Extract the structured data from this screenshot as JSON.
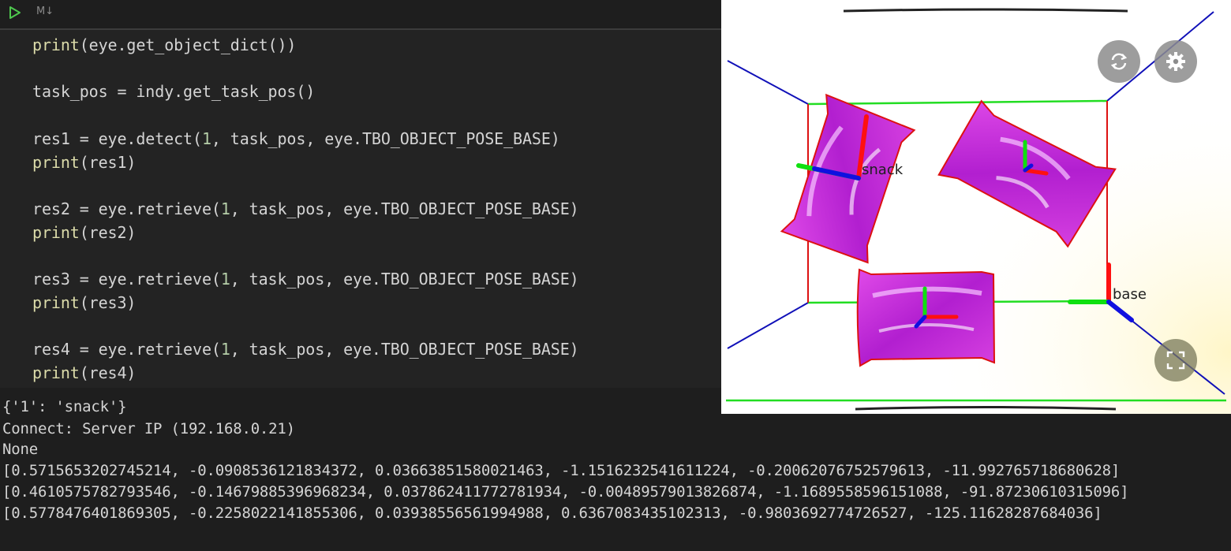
{
  "toolbar": {
    "run_icon": "play-icon",
    "markdown_badge": "M↓"
  },
  "code": {
    "lines": [
      {
        "parts": [
          "print",
          "(eye.get_object_dict())"
        ]
      },
      {
        "text": "task_pos = indy.get_task_pos()"
      },
      {
        "before": "res1 = eye.detect(",
        "num": "1",
        "after": ", task_pos, eye.TBO_OBJECT_POSE_BASE)"
      },
      {
        "parts": [
          "print",
          "(res1)"
        ]
      },
      {
        "before": "res2 = eye.retrieve(",
        "num": "1",
        "after": ", task_pos, eye.TBO_OBJECT_POSE_BASE)"
      },
      {
        "parts": [
          "print",
          "(res2)"
        ]
      },
      {
        "before": "res3 = eye.retrieve(",
        "num": "1",
        "after": ", task_pos, eye.TBO_OBJECT_POSE_BASE)"
      },
      {
        "parts": [
          "print",
          "(res3)"
        ]
      },
      {
        "before": "res4 = eye.retrieve(",
        "num": "1",
        "after": ", task_pos, eye.TBO_OBJECT_POSE_BASE)"
      },
      {
        "parts": [
          "print",
          "(res4)"
        ]
      }
    ]
  },
  "output": {
    "lines": [
      "{'1': 'snack'}",
      "Connect: Server IP (192.168.0.21)",
      "None",
      "[0.5715653202745214, -0.0908536121834372, 0.03663851580021463, -1.1516232541611224, -0.20062076752579613, -11.992765718680628]",
      "[0.4610575782793546, -0.14679885396968234, 0.037862411772781934, -0.00489579013826874, -1.1689558596151088, -91.87230610315096]",
      "[0.5778476401869305, -0.2258022141855306, 0.03938556561994988, 0.6367083435102313, -0.9803692774726527, -125.11628287684036]"
    ]
  },
  "viewer": {
    "labels": {
      "snack": "snack",
      "base": "base"
    },
    "buttons": {
      "rotate": "rotate-icon",
      "settings": "gear-icon",
      "fullscreen": "fullscreen-icon"
    },
    "colors": {
      "box_green": "#22dd22",
      "box_red": "#dd1111",
      "frustum_blue": "#1010b8",
      "package_magenta": "#c026d3",
      "axis_x": "#ff1010",
      "axis_y": "#10e010",
      "axis_z": "#1010e0"
    }
  }
}
